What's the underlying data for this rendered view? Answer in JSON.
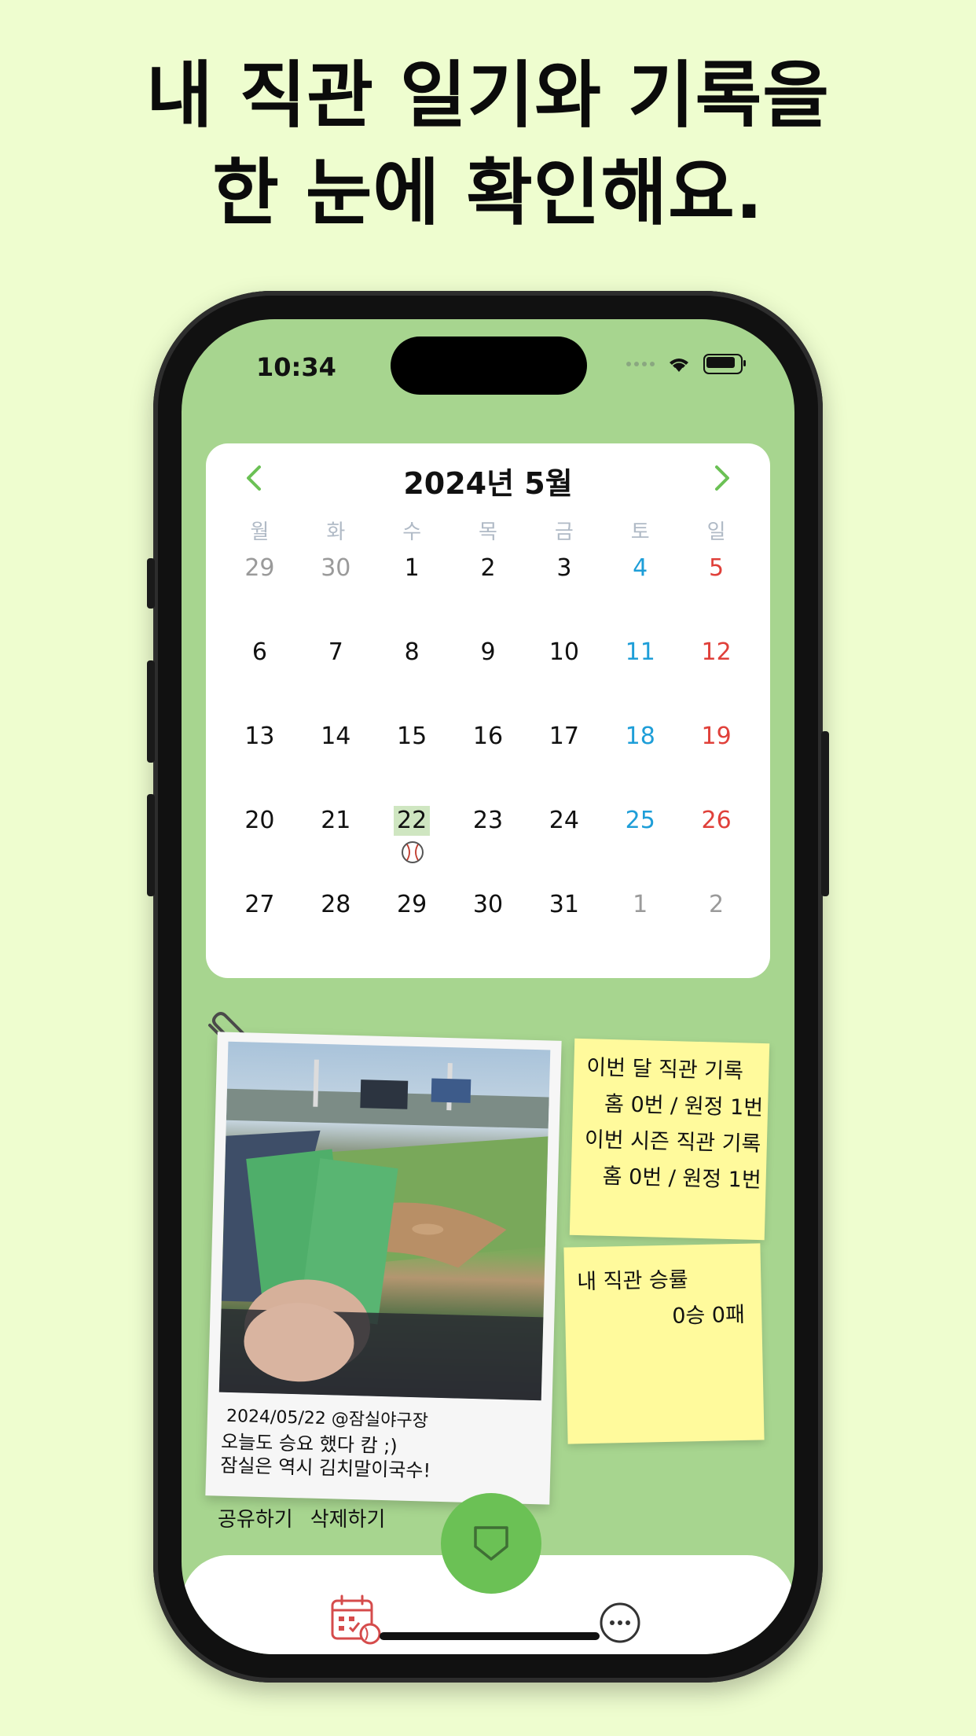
{
  "headline": {
    "line1": "내 직관 일기와 기록을",
    "line2": "한 눈에 확인해요."
  },
  "status_bar": {
    "time": "10:34"
  },
  "calendar": {
    "title": "2024년 5월",
    "weekdays": [
      "월",
      "화",
      "수",
      "목",
      "금",
      "토",
      "일"
    ],
    "weeks": [
      [
        "29",
        "30",
        "1",
        "2",
        "3",
        "4",
        "5"
      ],
      [
        "6",
        "7",
        "8",
        "9",
        "10",
        "11",
        "12"
      ],
      [
        "13",
        "14",
        "15",
        "16",
        "17",
        "18",
        "19"
      ],
      [
        "20",
        "21",
        "22",
        "23",
        "24",
        "25",
        "26"
      ],
      [
        "27",
        "28",
        "29",
        "30",
        "31",
        "1",
        "2"
      ]
    ],
    "selected_day": "22",
    "colors": {
      "saturday": "#1e9ed8",
      "sunday": "#e0403a",
      "selected_bg": "#cfe6c1"
    }
  },
  "diary": {
    "date_place": "2024/05/22  @잠실야구장",
    "memo_line1": "오늘도 승요 했다 캄 ;)",
    "memo_line2": "잠실은 역시 김치말이국수!"
  },
  "stats": {
    "monthly_label": "이번 달 직관 기록",
    "monthly_value": "홈 0번 / 원정 1번",
    "season_label": "이번 시즌 직관 기록",
    "season_value": "홈 0번 / 원정 1번",
    "winrate_label": "내 직관 승률",
    "winrate_value": "0승 0패"
  },
  "actions": {
    "share": "공유하기",
    "delete": "삭제하기"
  },
  "theme": {
    "accent": "#6bc155",
    "background": "#a7d58f",
    "note": "#fffa9c"
  },
  "icons": {
    "prev": "chevron-left-icon",
    "next": "chevron-right-icon",
    "fab": "home-plate-icon",
    "tab_calendar": "calendar-baseball-icon",
    "tab_more": "more-icon"
  }
}
